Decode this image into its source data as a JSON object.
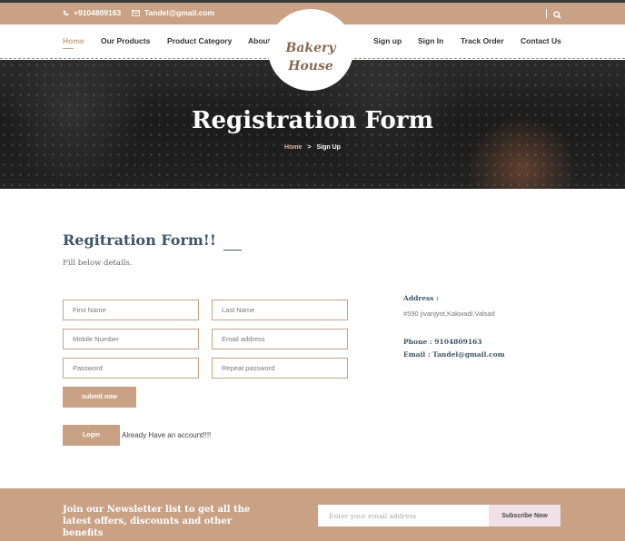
{
  "topbar": {
    "phone": "+9104809163",
    "email": "Tandel@gmail.com",
    "icons": {
      "phone": "phone-icon",
      "email": "envelope-icon",
      "search": "search-icon"
    }
  },
  "nav": {
    "left": [
      "Home",
      "Our Products",
      "Product Category",
      "About Us"
    ],
    "right": [
      "Sign up",
      "Sign In",
      "Track Order",
      "Contact Us"
    ],
    "active": "Home"
  },
  "logo": {
    "line1": "Bakery",
    "line2": "House"
  },
  "hero": {
    "title": "Registration Form",
    "breadcrumb": {
      "home": "Home",
      "separator": ">",
      "current": "Sign Up"
    }
  },
  "form": {
    "heading": "Regitration Form!!",
    "subtitle": "Fill below details.",
    "fields": {
      "first_name": "First Name",
      "last_name": "Last Name",
      "mobile": "Mobile Number",
      "email": "Email address",
      "password": "Password",
      "repeat_password": "Repeat password"
    },
    "submit_label": "submit now",
    "login_label": "Login",
    "login_note": "Already Have an account!!!!"
  },
  "contact": {
    "address_label": "Address :",
    "address": "#590 jivanjyot,Kakwadi,Valsad",
    "phone": "Phone : 9104809163",
    "email": "Email : Tandel@gmail.com"
  },
  "newsletter": {
    "text": "Join our Newsletter list to get all the latest offers, discounts and other benefits",
    "placeholder": "Enter your email address",
    "button": "Subscribe Now"
  },
  "colors": {
    "accent": "#c9a286",
    "heading": "#3f5565",
    "subscribe_bg": "#efe1e6"
  }
}
